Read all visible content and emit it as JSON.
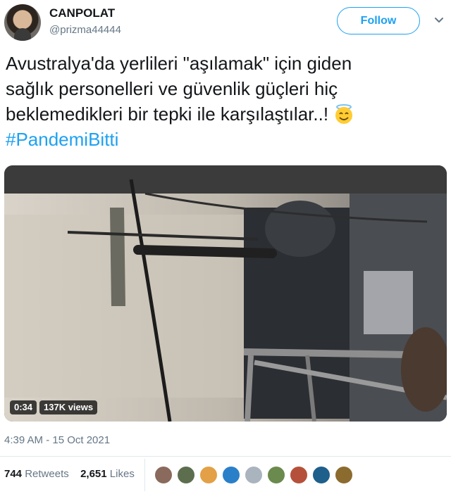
{
  "user": {
    "display_name": "CANPOLAT",
    "handle": "@prizma44444",
    "follow_label": "Follow"
  },
  "tweet": {
    "text_line1": "Avustralya'da yerlileri \"aşılamak\" için giden",
    "text_line2": "sağlık personelleri ve güvenlik güçleri hiç",
    "text_line3": "beklemedikleri bir tepki ile karşılaştılar..!",
    "emoji": "smiling-face-with-halo",
    "hashtag": "#PandemiBitti"
  },
  "video": {
    "duration": "0:34",
    "views": "137K views"
  },
  "meta": {
    "timestamp": "4:39 AM - 15 Oct 2021"
  },
  "stats": {
    "retweets_count": "744",
    "retweets_label": "Retweets",
    "likes_count": "2,651",
    "likes_label": "Likes"
  },
  "colors": {
    "accent": "#1da1f2",
    "secondary_text": "#657786",
    "primary_text": "#14171a"
  },
  "liker_avatars": [
    "#8a6a5c",
    "#5d6e4f",
    "#e3a046",
    "#2a7fc9",
    "#a9b4bf",
    "#6b8a4e",
    "#b5513a",
    "#1f5f8b",
    "#8c6b2f"
  ]
}
